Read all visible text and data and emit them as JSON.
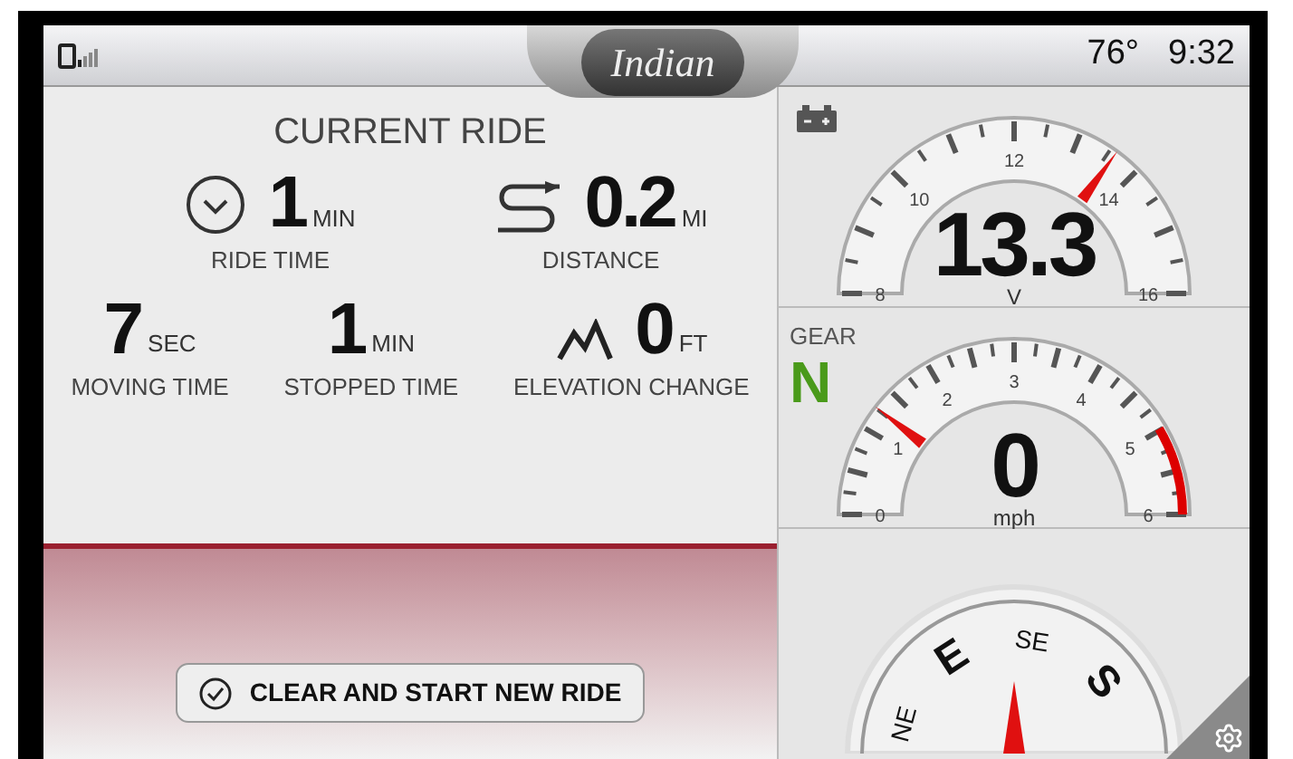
{
  "status_bar": {
    "logo": "Indian",
    "temperature": "76°",
    "time": "9:32"
  },
  "ride": {
    "title": "CURRENT RIDE",
    "stats": [
      {
        "kind": "ride_time",
        "value": "1",
        "unit": "MIN",
        "label": "RIDE TIME"
      },
      {
        "kind": "distance",
        "value": "0.2",
        "unit": "MI",
        "label": "DISTANCE"
      },
      {
        "kind": "moving_time",
        "value": "7",
        "unit": "SEC",
        "label": "MOVING TIME"
      },
      {
        "kind": "stopped_time",
        "value": "1",
        "unit": "MIN",
        "label": "STOPPED TIME"
      },
      {
        "kind": "elevation",
        "value": "0",
        "unit": "FT",
        "label": "ELEVATION CHANGE"
      }
    ],
    "button": "CLEAR AND START NEW RIDE"
  },
  "gauges": [
    {
      "kind": "voltage",
      "labels": [
        "8",
        "10",
        "12",
        "14",
        "16"
      ],
      "level": 0.7,
      "reading": "13.3",
      "unit": "V"
    },
    {
      "kind": "speed",
      "gear_label": "GEAR",
      "gear": "N",
      "labels": [
        "0",
        "1",
        "2",
        "3",
        "4",
        "5",
        "6"
      ],
      "level": 0.21,
      "reading": "0",
      "unit": "mph"
    }
  ],
  "compass": {
    "points": [
      "NE",
      "E",
      "SE",
      "S"
    ]
  }
}
